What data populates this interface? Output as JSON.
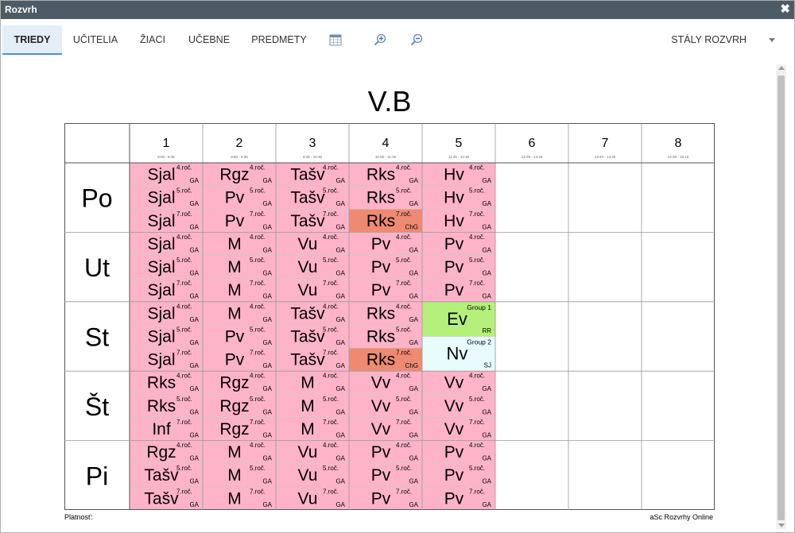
{
  "window": {
    "title": "Rozvrh",
    "close": "✖"
  },
  "tabs": [
    {
      "label": "TRIEDY",
      "active": true
    },
    {
      "label": "UČITELIA",
      "active": false
    },
    {
      "label": "ŽIACI",
      "active": false
    },
    {
      "label": "UČEBNE",
      "active": false
    },
    {
      "label": "PREDMETY",
      "active": false
    }
  ],
  "toolbar_icons": [
    "calendar-icon",
    "zoom-in-icon",
    "zoom-out-icon"
  ],
  "schedule_select": "STÁLY ROZVRH",
  "class_name": "V.B",
  "periods": [
    {
      "num": "1",
      "time": "8:00 - 8:45"
    },
    {
      "num": "2",
      "time": "8:50 - 9:35"
    },
    {
      "num": "3",
      "time": "9:45 - 10:30"
    },
    {
      "num": "4",
      "time": "10:50 - 11:35"
    },
    {
      "num": "5",
      "time": "11:45 - 12:30"
    },
    {
      "num": "6",
      "time": "12:35 - 13:15"
    },
    {
      "num": "7",
      "time": "13:40 - 14:20"
    },
    {
      "num": "8",
      "time": "14:30 - 15:10"
    }
  ],
  "colors": {
    "pink": "#ffb3c9",
    "red": "#ef8a72",
    "green": "#b5f07a",
    "lightblue": "#e8fbfd",
    "border": "#777777"
  },
  "days": [
    {
      "name": "Po",
      "lessons": [
        {
          "p": 1,
          "rows": [
            {
              "s": "Sjal",
              "g": "4.roč.",
              "t": "GA"
            },
            {
              "s": "Sjal",
              "g": "5.roč.",
              "t": "GA"
            },
            {
              "s": "Sjal",
              "g": "7.roč.",
              "t": "GA"
            }
          ]
        },
        {
          "p": 2,
          "rows": [
            {
              "s": "Rgz",
              "g": "4.roč.",
              "t": "GA"
            },
            {
              "s": "Pv",
              "g": "5.roč.",
              "t": "GA"
            },
            {
              "s": "Pv",
              "g": "7.roč.",
              "t": "GA"
            }
          ]
        },
        {
          "p": 3,
          "rows": [
            {
              "s": "Tašv",
              "g": "4.roč.",
              "t": "GA"
            },
            {
              "s": "Tašv",
              "g": "5.roč.",
              "t": "GA"
            },
            {
              "s": "Tašv",
              "g": "7.roč.",
              "t": "GA"
            }
          ]
        },
        {
          "p": 4,
          "rows": [
            {
              "s": "Rks",
              "g": "4.roč.",
              "t": "GA"
            },
            {
              "s": "Rks",
              "g": "5.roč.",
              "t": "GA"
            },
            {
              "s": "Rks",
              "g": "7.roč.",
              "t": "ChG",
              "c": "red"
            }
          ]
        },
        {
          "p": 5,
          "rows": [
            {
              "s": "Hv",
              "g": "4.roč.",
              "t": "GA"
            },
            {
              "s": "Hv",
              "g": "5.roč.",
              "t": "GA"
            },
            {
              "s": "Hv",
              "g": "7.roč.",
              "t": "GA"
            }
          ]
        }
      ]
    },
    {
      "name": "Ut",
      "lessons": [
        {
          "p": 1,
          "rows": [
            {
              "s": "Sjal",
              "g": "4.roč.",
              "t": "GA"
            },
            {
              "s": "Sjal",
              "g": "5.roč.",
              "t": "GA"
            },
            {
              "s": "Sjal",
              "g": "7.roč.",
              "t": "GA"
            }
          ]
        },
        {
          "p": 2,
          "rows": [
            {
              "s": "M",
              "g": "4.roč.",
              "t": "GA"
            },
            {
              "s": "M",
              "g": "5.roč.",
              "t": "GA"
            },
            {
              "s": "M",
              "g": "7.roč.",
              "t": "GA"
            }
          ]
        },
        {
          "p": 3,
          "rows": [
            {
              "s": "Vu",
              "g": "4.roč.",
              "t": "GA"
            },
            {
              "s": "Vu",
              "g": "5.roč.",
              "t": "GA"
            },
            {
              "s": "Vu",
              "g": "7.roč.",
              "t": "GA"
            }
          ]
        },
        {
          "p": 4,
          "rows": [
            {
              "s": "Pv",
              "g": "4.roč.",
              "t": "GA"
            },
            {
              "s": "Pv",
              "g": "5.roč.",
              "t": "GA"
            },
            {
              "s": "Pv",
              "g": "7.roč.",
              "t": "GA"
            }
          ]
        },
        {
          "p": 5,
          "rows": [
            {
              "s": "Pv",
              "g": "4.roč.",
              "t": "GA"
            },
            {
              "s": "Pv",
              "g": "5.roč.",
              "t": "GA"
            },
            {
              "s": "Pv",
              "g": "7.roč.",
              "t": "GA"
            }
          ]
        }
      ]
    },
    {
      "name": "St",
      "lessons": [
        {
          "p": 1,
          "rows": [
            {
              "s": "Sjal",
              "g": "4.roč.",
              "t": "GA"
            },
            {
              "s": "Sjal",
              "g": "5.roč.",
              "t": "GA"
            },
            {
              "s": "Sjal",
              "g": "7.roč.",
              "t": "GA"
            }
          ]
        },
        {
          "p": 2,
          "rows": [
            {
              "s": "M",
              "g": "4.roč.",
              "t": "GA"
            },
            {
              "s": "Pv",
              "g": "5.roč.",
              "t": "GA"
            },
            {
              "s": "Pv",
              "g": "7.roč.",
              "t": "GA"
            }
          ]
        },
        {
          "p": 3,
          "rows": [
            {
              "s": "Tašv",
              "g": "4.roč.",
              "t": "GA"
            },
            {
              "s": "Tašv",
              "g": "5.roč.",
              "t": "GA"
            },
            {
              "s": "Tašv",
              "g": "7.roč.",
              "t": "GA"
            }
          ]
        },
        {
          "p": 4,
          "rows": [
            {
              "s": "Rks",
              "g": "4.roč.",
              "t": "GA"
            },
            {
              "s": "Rks",
              "g": "5.roč.",
              "t": "GA"
            },
            {
              "s": "Rks",
              "g": "7.roč.",
              "t": "ChG",
              "c": "red"
            }
          ]
        },
        {
          "p": 5,
          "groups": [
            {
              "s": "Ev",
              "g": "Group 1",
              "t": "RR",
              "c": "green"
            },
            {
              "s": "Nv",
              "g": "Group 2",
              "t": "SJ",
              "c": "lightblue"
            }
          ]
        }
      ]
    },
    {
      "name": "Št",
      "lessons": [
        {
          "p": 1,
          "rows": [
            {
              "s": "Rks",
              "g": "4.roč.",
              "t": "GA"
            },
            {
              "s": "Rks",
              "g": "5.roč.",
              "t": "GA"
            },
            {
              "s": "Inf",
              "g": "7.roč.",
              "t": "GA"
            }
          ]
        },
        {
          "p": 2,
          "rows": [
            {
              "s": "Rgz",
              "g": "4.roč.",
              "t": "GA"
            },
            {
              "s": "Rgz",
              "g": "5.roč.",
              "t": "GA"
            },
            {
              "s": "Rgz",
              "g": "7.roč.",
              "t": "GA"
            }
          ]
        },
        {
          "p": 3,
          "rows": [
            {
              "s": "M",
              "g": "4.roč.",
              "t": "GA"
            },
            {
              "s": "M",
              "g": "5.roč.",
              "t": "GA"
            },
            {
              "s": "M",
              "g": "7.roč.",
              "t": "GA"
            }
          ]
        },
        {
          "p": 4,
          "rows": [
            {
              "s": "Vv",
              "g": "4.roč.",
              "t": "GA"
            },
            {
              "s": "Vv",
              "g": "5.roč.",
              "t": "GA"
            },
            {
              "s": "Vv",
              "g": "7.roč.",
              "t": "GA"
            }
          ]
        },
        {
          "p": 5,
          "rows": [
            {
              "s": "Vv",
              "g": "4.roč.",
              "t": "GA"
            },
            {
              "s": "Vv",
              "g": "5.roč.",
              "t": "GA"
            },
            {
              "s": "Vv",
              "g": "7.roč.",
              "t": "GA"
            }
          ]
        }
      ]
    },
    {
      "name": "Pi",
      "lessons": [
        {
          "p": 1,
          "rows": [
            {
              "s": "Rgz",
              "g": "4.roč.",
              "t": "GA"
            },
            {
              "s": "Tašv",
              "g": "5.roč.",
              "t": "GA"
            },
            {
              "s": "Tašv",
              "g": "7.roč.",
              "t": "GA"
            }
          ]
        },
        {
          "p": 2,
          "rows": [
            {
              "s": "M",
              "g": "4.roč.",
              "t": "GA"
            },
            {
              "s": "M",
              "g": "5.roč.",
              "t": "GA"
            },
            {
              "s": "M",
              "g": "7.roč.",
              "t": "GA"
            }
          ]
        },
        {
          "p": 3,
          "rows": [
            {
              "s": "Vu",
              "g": "4.roč.",
              "t": "GA"
            },
            {
              "s": "Vu",
              "g": "5.roč.",
              "t": "GA"
            },
            {
              "s": "Vu",
              "g": "7.roč.",
              "t": "GA"
            }
          ]
        },
        {
          "p": 4,
          "rows": [
            {
              "s": "Pv",
              "g": "4.roč.",
              "t": "GA"
            },
            {
              "s": "Pv",
              "g": "5.roč.",
              "t": "GA"
            },
            {
              "s": "Pv",
              "g": "7.roč.",
              "t": "GA"
            }
          ]
        },
        {
          "p": 5,
          "rows": [
            {
              "s": "Pv",
              "g": "4.roč.",
              "t": "GA"
            },
            {
              "s": "Pv",
              "g": "5.roč.",
              "t": "GA"
            },
            {
              "s": "Pv",
              "g": "7.roč.",
              "t": "GA"
            }
          ]
        }
      ]
    }
  ],
  "footer": {
    "left": "Platnosť:",
    "right": "aSc Rozvrhy Online"
  }
}
